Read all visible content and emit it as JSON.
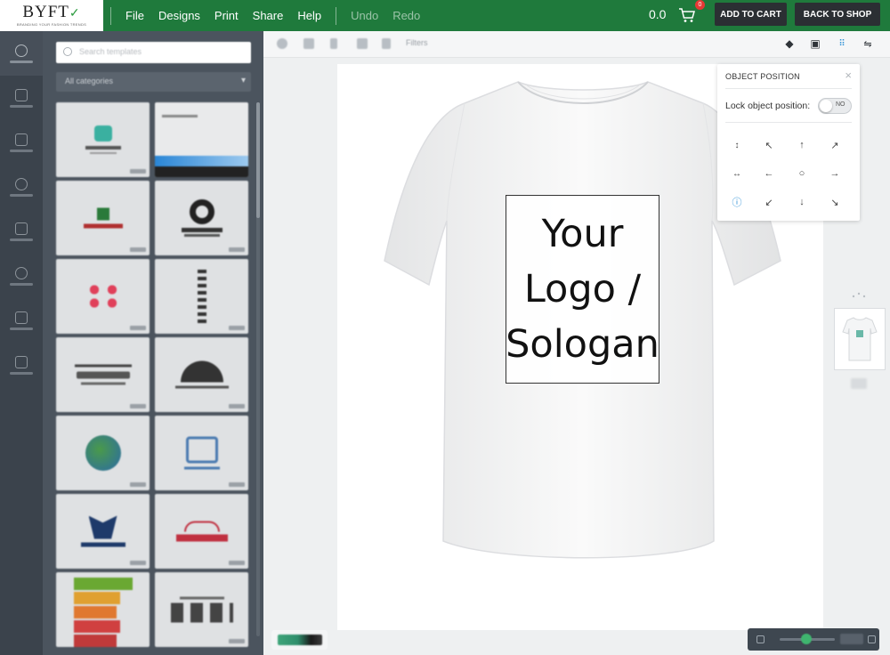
{
  "brand": {
    "name": "BYFT",
    "tagline": "BRANDING YOUR FASHION TRENDS"
  },
  "menu": {
    "items": [
      "File",
      "Designs",
      "Print",
      "Share",
      "Help"
    ],
    "undo": "Undo",
    "redo": "Redo"
  },
  "cart": {
    "price": "0.0",
    "count": "0",
    "add_to_cart": "ADD TO CART",
    "back_to_shop": "BACK TO SHOP"
  },
  "left_panel": {
    "search_placeholder": "Search templates",
    "category": "All categories",
    "rail_icons": [
      "home-icon",
      "clipart-icon",
      "image-icon",
      "shape-icon",
      "text-icon",
      "qrcode-icon",
      "layers-icon",
      "template-icon"
    ]
  },
  "toolbar": {
    "filter_label": "Filters"
  },
  "canvas": {
    "logo_text": "Your\nLogo /\nSologan"
  },
  "object_position": {
    "title": "OBJECT POSITION",
    "lock_label": "Lock object position:",
    "toggle_state": "NO"
  },
  "colors": {
    "brand_green": "#1f7a3c",
    "panel": "#4b545e",
    "rail": "#3b434c",
    "info_blue": "#2a8fd6"
  }
}
